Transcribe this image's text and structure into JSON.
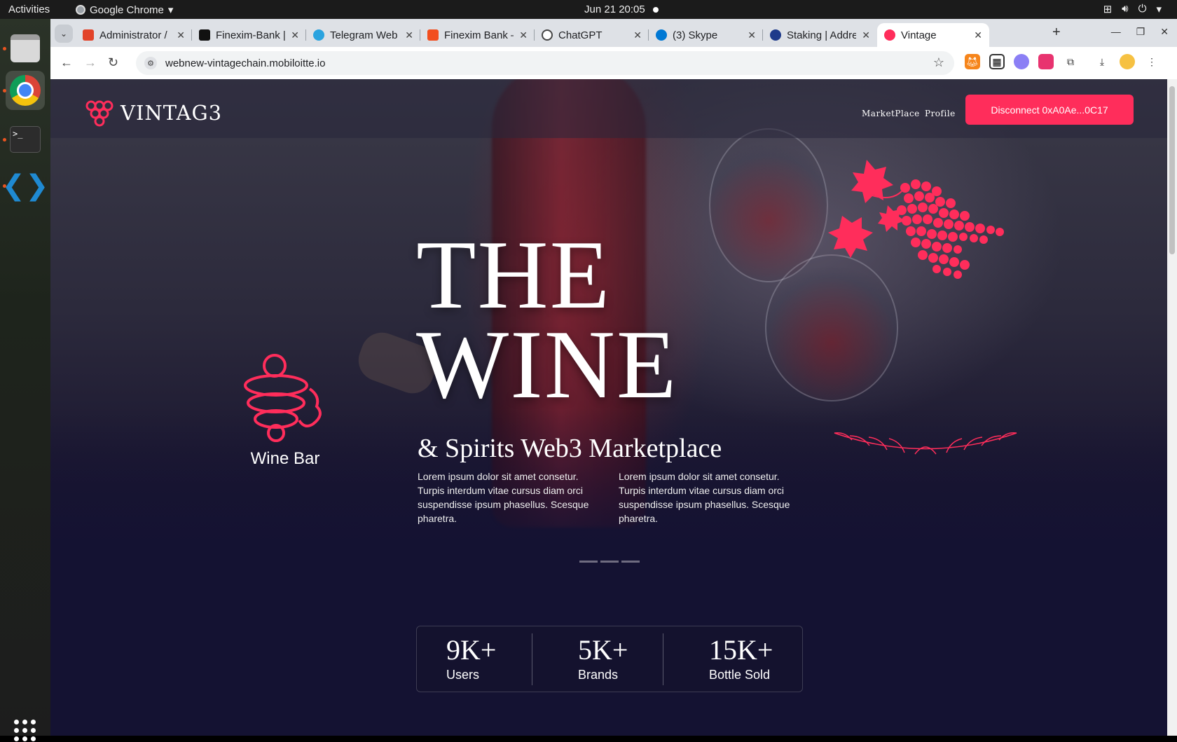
{
  "system": {
    "activities": "Activities",
    "app_name": "Google Chrome",
    "clock": "Jun 21  20:05"
  },
  "tabs": [
    {
      "title": "Administrator /",
      "color": "#e24329"
    },
    {
      "title": "Finexim-Bank |",
      "color": "#111111"
    },
    {
      "title": "Telegram Web",
      "color": "#2aa3df"
    },
    {
      "title": "Finexim Bank –",
      "color": "#f24e1e"
    },
    {
      "title": "ChatGPT",
      "color": "#444444"
    },
    {
      "title": "(3) Skype",
      "color": "#0078d4"
    },
    {
      "title": "Staking | Addre",
      "color": "#1e3a8a"
    },
    {
      "title": "Vintage",
      "color": "#ff2d5b"
    }
  ],
  "omnibox": {
    "url": "webnew-vintagechain.mobiloitte.io"
  },
  "site": {
    "logo_text": "VINTAG3",
    "nav": {
      "marketplace": "MarketPlace",
      "profile": "Profile"
    },
    "connect_label": "Disconnect 0xA0Ae...0C17",
    "hero": {
      "line1": "THE",
      "line2": "WINE",
      "subtitle": "& Spirits Web3 Marketplace",
      "para_left": "Lorem ipsum dolor sit amet consetur. Turpis interdum vitae cursus diam orci suspendisse ipsum phasellus. Scesque pharetra.",
      "para_right": "Lorem ipsum dolor sit amet consetur. Turpis interdum vitae cursus diam orci suspendisse ipsum phasellus. Scesque pharetra."
    },
    "wine_bar_label": "Wine Bar",
    "stats": [
      {
        "value": "9K+",
        "label": "Users"
      },
      {
        "value": "5K+",
        "label": "Brands"
      },
      {
        "value": "15K+",
        "label": "Bottle Sold"
      }
    ],
    "accent_color": "#ff2d5b"
  }
}
